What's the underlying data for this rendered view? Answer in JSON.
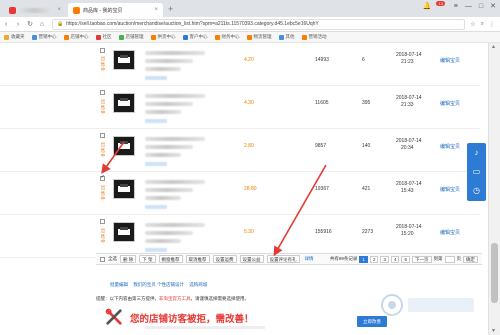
{
  "browser": {
    "tabs": [
      {
        "label": "",
        "active": false
      },
      {
        "label": "商品库 - 我的宝贝",
        "active": true
      }
    ],
    "new_tab": "+",
    "url": "https://sell.taobao.com/auction/merchandise/auction_list.htm?spm=a211ts.11570393.category.d45.1ebc5e16UqhY",
    "notification_count": "13",
    "bookmarks": [
      "收藏夹",
      "营销中心",
      "店铺中心",
      "社区",
      "店铺管理",
      "供货中心",
      "客户中心",
      "财务中心",
      "物流管理",
      "其他",
      "营销活动"
    ]
  },
  "products": [
    {
      "status": "出售中",
      "price": "4.20",
      "sales": "14993",
      "stock": "6",
      "date": "2018-07-14",
      "time": "21:23",
      "action": "编辑宝贝",
      "checked": false
    },
    {
      "status": "出售中",
      "price": "4.30",
      "sales": "11605",
      "stock": "395",
      "date": "2018-07-14",
      "time": "21:33",
      "action": "编辑宝贝",
      "checked": false
    },
    {
      "status": "出售中",
      "price": "2.80",
      "sales": "9857",
      "stock": "140",
      "date": "2018-07-14",
      "time": "20:34",
      "action": "编辑宝贝",
      "checked": false
    },
    {
      "status": "出售中",
      "price": "28.80",
      "sales": "19367",
      "stock": "421",
      "date": "2018-07-14",
      "time": "15:43",
      "action": "编辑宝贝",
      "checked": true
    },
    {
      "status": "出售中",
      "price": "5.30",
      "sales": "155916",
      "stock": "2273",
      "date": "2018-07-14",
      "time": "15:20",
      "action": "编辑宝贝",
      "checked": false
    }
  ],
  "toolbar": {
    "select_all": "全选",
    "buttons": [
      "删 除",
      "下 架",
      "橱窗推荐",
      "取消推荐",
      "设置运费",
      "设置公益",
      "设置评论有礼"
    ],
    "link": "详情",
    "total": "共有99条记录",
    "pages": [
      "1",
      "2",
      "3",
      "4",
      "5"
    ],
    "next": "下一页",
    "goto_label": "到第",
    "goto_unit": "页",
    "confirm": "确定"
  },
  "promo": {
    "line1_a": "批量编辑",
    "line1_b": "我们的宝贝 个性店铺设计",
    "line1_c": "选购商城",
    "line2_prefix": "提醒：以下内容由第三方提供，",
    "line2_red": "非淘宝官方工具",
    "line2_suffix": "，请谨慎选择需要选择使用。",
    "headline": "您的店铺访客被拒，需改善！",
    "cta": "立即改善"
  },
  "colors": {
    "accent": "#2e7bd6",
    "price": "#f57c00",
    "alert": "#e53935"
  }
}
